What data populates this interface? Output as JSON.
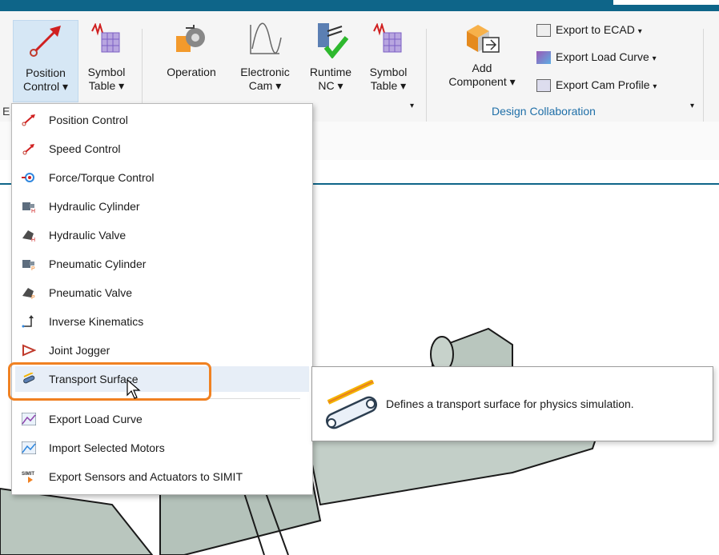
{
  "ribbon": {
    "buttons": {
      "position_control": [
        "Position",
        "Control ▾"
      ],
      "symbol_table_1": [
        "Symbol",
        "Table ▾"
      ],
      "operation": "Operation",
      "electronic_cam": [
        "Electronic",
        "Cam ▾"
      ],
      "runtime_nc": [
        "Runtime",
        "NC ▾"
      ],
      "symbol_table_2": [
        "Symbol",
        "Table ▾"
      ],
      "add_component": [
        "Add",
        "Component ▾"
      ]
    },
    "small_items": {
      "export_ecad": "Export to ECAD",
      "export_load_curve": "Export Load Curve",
      "export_cam_profile": "Export Cam Profile"
    },
    "groups": {
      "design_collaboration": "Design Collaboration",
      "left_cut": "E"
    },
    "dropdown_arrow": "▾"
  },
  "menu": {
    "items": [
      {
        "label": "Position Control",
        "icon": "position-control-icon"
      },
      {
        "label": "Speed Control",
        "icon": "speed-control-icon"
      },
      {
        "label": "Force/Torque Control",
        "icon": "force-torque-icon"
      },
      {
        "label": "Hydraulic Cylinder",
        "icon": "hydraulic-cylinder-icon"
      },
      {
        "label": "Hydraulic Valve",
        "icon": "hydraulic-valve-icon"
      },
      {
        "label": "Pneumatic Cylinder",
        "icon": "pneumatic-cylinder-icon"
      },
      {
        "label": "Pneumatic Valve",
        "icon": "pneumatic-valve-icon"
      },
      {
        "label": "Inverse Kinematics",
        "icon": "inverse-kinematics-icon"
      },
      {
        "label": "Joint Jogger",
        "icon": "joint-jogger-icon"
      },
      {
        "label": "Transport Surface",
        "icon": "transport-surface-icon"
      },
      {
        "label": "Export Load Curve",
        "icon": "load-curve-icon"
      },
      {
        "label": "Import Selected Motors",
        "icon": "import-motors-icon"
      },
      {
        "label": "Export Sensors and Actuators to SIMIT",
        "icon": "simit-icon"
      }
    ],
    "highlighted_item": "Transport Surface",
    "simit_badge": "SIMIT"
  },
  "tooltip": {
    "text": "Defines a transport surface for physics simulation."
  },
  "colors": {
    "accent": "#0e6589",
    "highlight": "#f08122",
    "group_label": "#1f6fa8"
  }
}
